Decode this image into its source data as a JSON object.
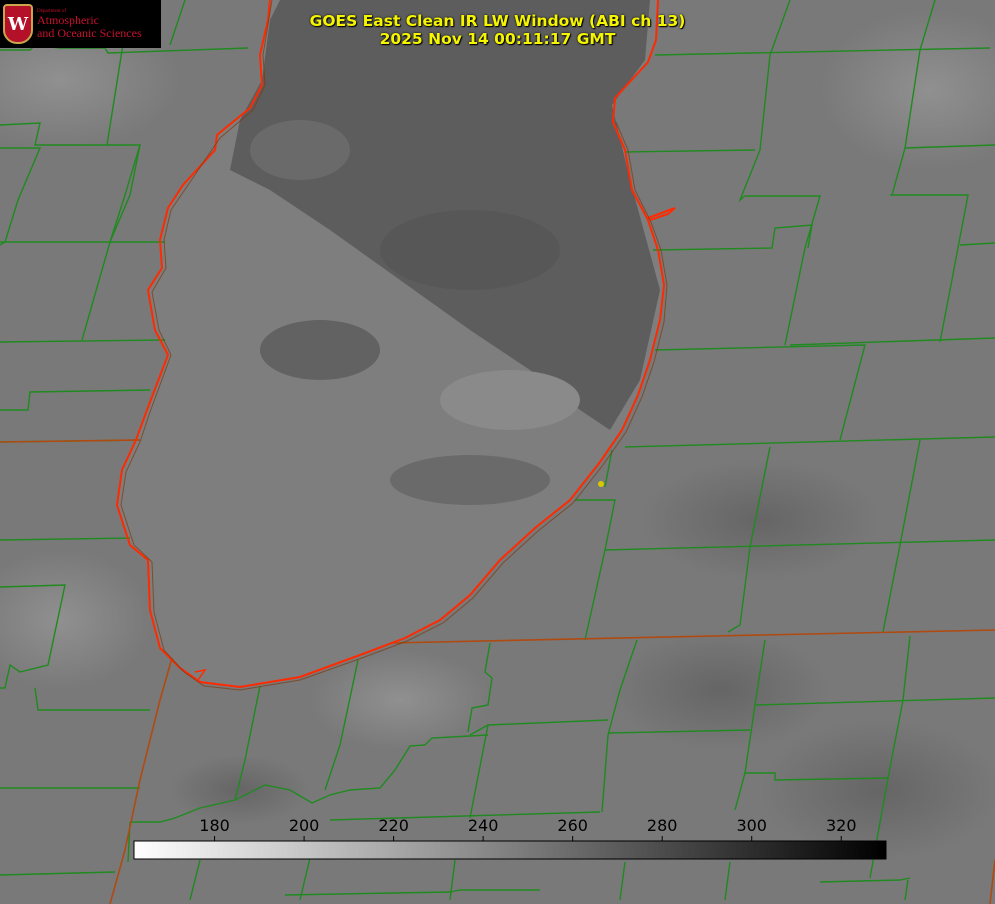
{
  "title": {
    "line1": "GOES East Clean IR LW Window (ABI ch 13)",
    "line2": "2025 Nov 14 00:11:17 GMT"
  },
  "logo": {
    "department_small": "Department of",
    "line1": "Atmospheric",
    "line2": "and Oceanic Sciences",
    "crest_letter": "W",
    "icon": "uw-crest-icon"
  },
  "colorbar": {
    "min": 162,
    "max": 330,
    "ticks": [
      180,
      200,
      220,
      240,
      260,
      280,
      300,
      320
    ],
    "tick_labels": [
      "180",
      "200",
      "220",
      "240",
      "260",
      "280",
      "300",
      "320"
    ],
    "colormap": "white-to-black (inverted grayscale)"
  },
  "colors": {
    "title_text": "#f5f500",
    "county_lines": "#1f8a1f",
    "state_lines": "#b04a10",
    "coastline": "#ff2a00",
    "marker": "#d8c800",
    "background": "#7a7a7a"
  }
}
